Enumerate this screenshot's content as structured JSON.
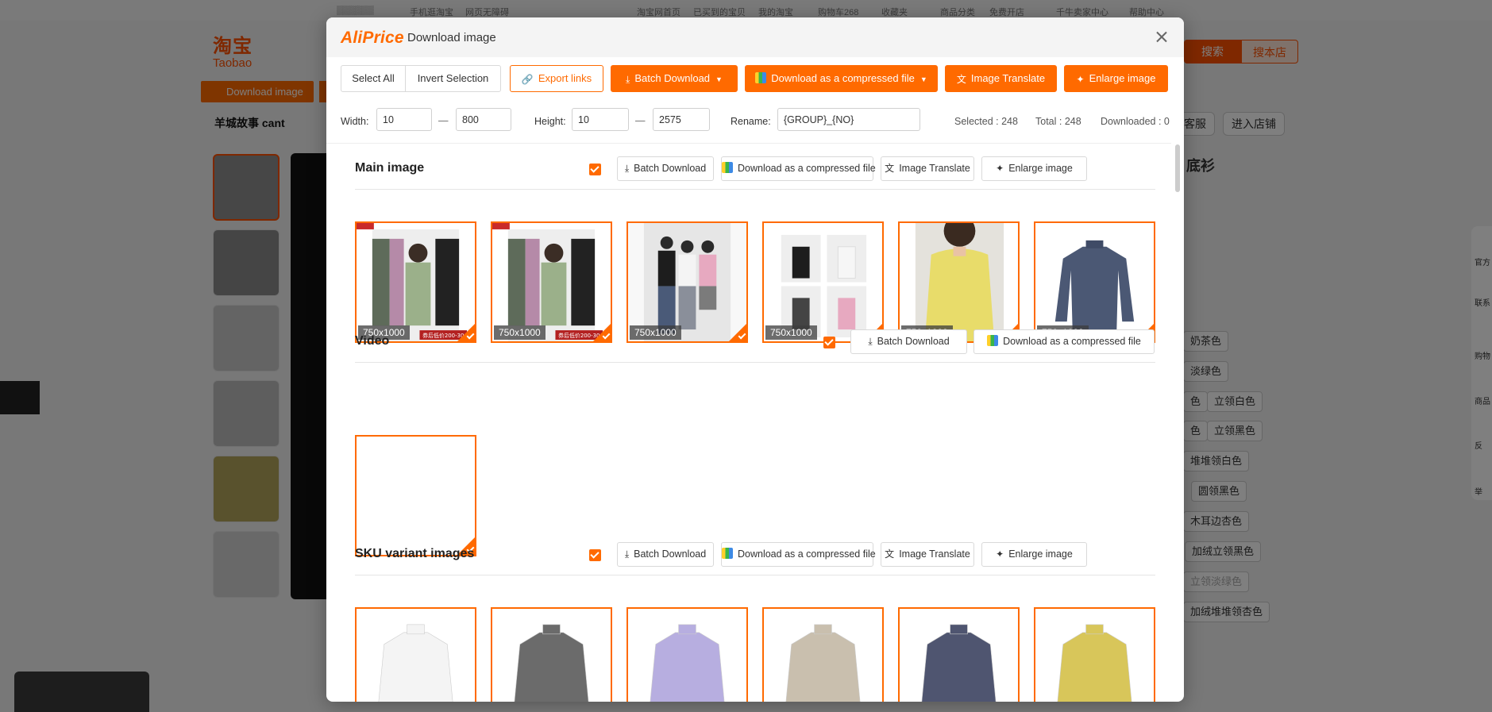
{
  "background": {
    "topbar": [
      "手机逛淘宝",
      "网页无障碍",
      "淘宝网首页",
      "已买到的宝贝",
      "我的淘宝",
      "购物车268",
      "收藏夹",
      "商品分类",
      "免费开店",
      "千牛卖家中心",
      "帮助中心"
    ],
    "logo_cn": "淘宝",
    "logo_en": "Taobao",
    "download_image_btn": "Download image",
    "shop_name": "羊城故事 cant",
    "search_btn": "搜索",
    "search_shop_btn": "搜本店",
    "service_btn": "客服",
    "enter_shop_btn": "进入店铺",
    "title_fragment": "底衫",
    "color_tags": [
      "奶茶色",
      "淡绿色",
      "色",
      "立领白色",
      "色",
      "立领黑色",
      "堆堆领白色",
      "圆领黑色",
      "木耳边杏色",
      "加绒立领黑色",
      "立领淡绿色",
      "加绒堆堆领杏色"
    ],
    "side_labels": [
      "官方",
      "联系",
      "购物",
      "商品",
      "反",
      "举"
    ]
  },
  "modal": {
    "brand": "AliPrice",
    "title": "Download image",
    "toolbar": {
      "select_all": "Select All",
      "invert_selection": "Invert Selection",
      "export_links": "Export links",
      "batch_download": "Batch Download",
      "download_compressed": "Download as a compressed file",
      "image_translate": "Image Translate",
      "enlarge_image": "Enlarge image"
    },
    "filter": {
      "width_label": "Width:",
      "width_min": "10",
      "width_max": "800",
      "height_label": "Height:",
      "height_min": "10",
      "height_max": "2575",
      "rename_label": "Rename:",
      "rename_value": "{GROUP}_{NO}",
      "selected": "Selected : 248",
      "total": "Total : 248",
      "downloaded": "Downloaded : 0"
    },
    "sections": {
      "main": {
        "title": "Main image",
        "batch_download": "Batch Download",
        "download_compressed": "Download as a compressed file",
        "image_translate": "Image Translate",
        "enlarge_image": "Enlarge image",
        "images": [
          {
            "size": "750x1000",
            "promo": "券后低价200-30"
          },
          {
            "size": "750x1000",
            "promo": "券后低价200-30"
          },
          {
            "size": "750x1000"
          },
          {
            "size": "750x1000"
          },
          {
            "size": "750x1000"
          },
          {
            "size": "750x1000"
          }
        ]
      },
      "video": {
        "title": "Video",
        "batch_download": "Batch Download",
        "download_compressed": "Download as a compressed file"
      },
      "sku": {
        "title": "SKU variant images",
        "batch_download": "Batch Download",
        "download_compressed": "Download as a compressed file",
        "image_translate": "Image Translate",
        "enlarge_image": "Enlarge image",
        "colors": [
          "#f4f4f4",
          "#6b6b6b",
          "#b7aee0",
          "#c9bfae",
          "#4f5570",
          "#d8c65a"
        ]
      }
    }
  },
  "colors": {
    "accent": "#ff6a00",
    "brand": "#ff5000"
  }
}
